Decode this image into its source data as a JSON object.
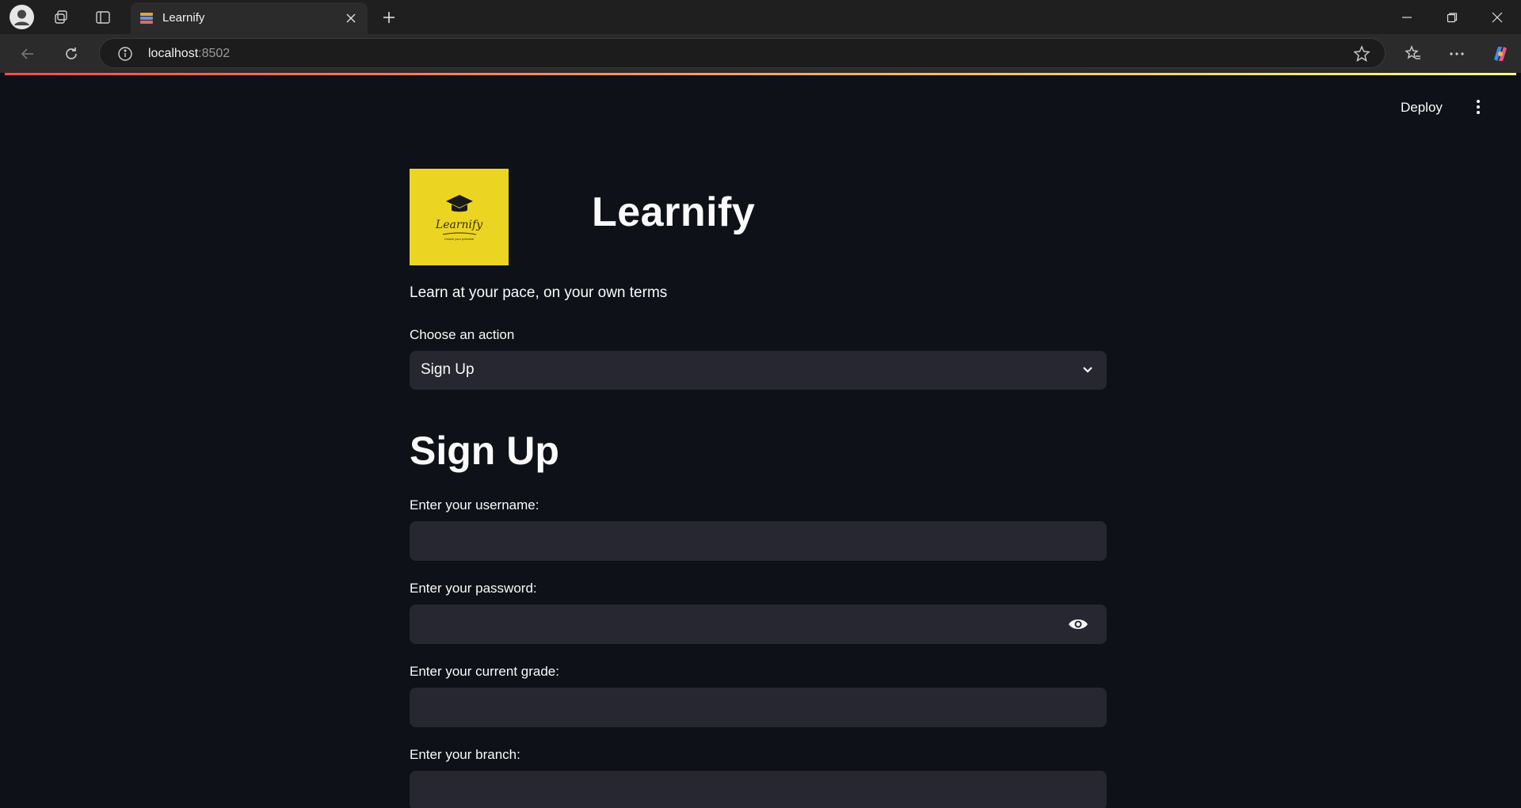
{
  "browser": {
    "tab_title": "Learnify",
    "url_host": "localhost",
    "url_port": ":8502"
  },
  "app": {
    "deploy_label": "Deploy",
    "logo_text": "Learnify",
    "logo_subtext": "Unlock your potential",
    "title": "Learnify",
    "tagline": "Learn at your pace, on your own terms",
    "action_label": "Choose an action",
    "action_value": "Sign Up",
    "section_title": "Sign Up",
    "fields": {
      "username_label": "Enter your username:",
      "password_label": "Enter your password:",
      "grade_label": "Enter your current grade:",
      "branch_label": "Enter your branch:"
    }
  },
  "colors": {
    "app_background": "#0e1117",
    "input_background": "#262730",
    "logo_background": "#ecd522",
    "decoration_start": "#ff4b4b",
    "decoration_end": "#fffd80"
  }
}
